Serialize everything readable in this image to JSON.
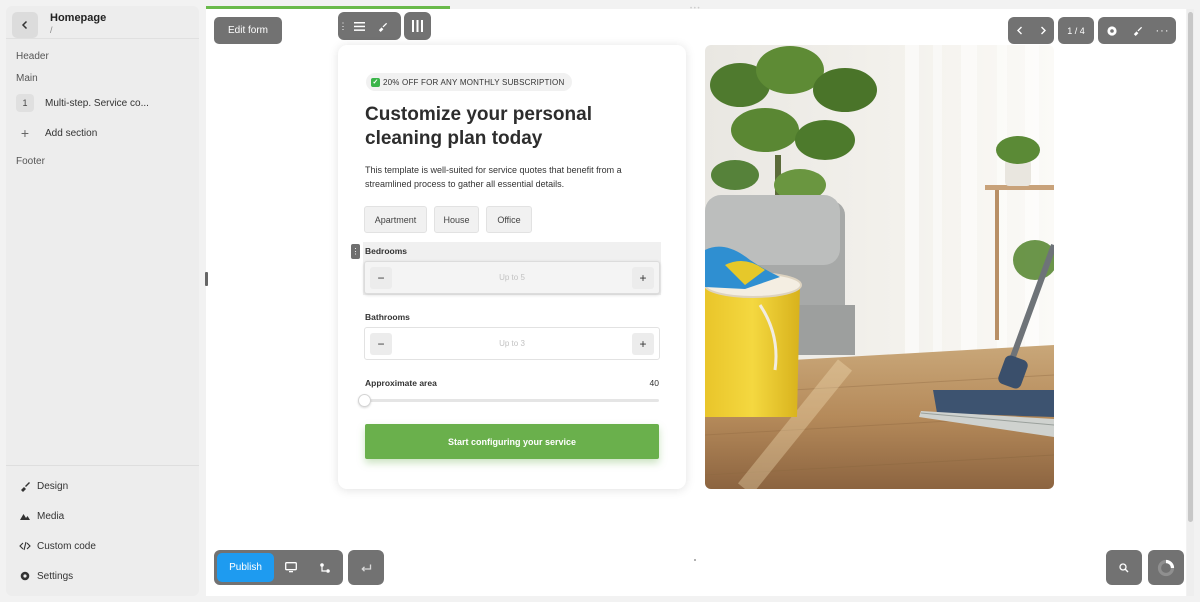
{
  "sidebar": {
    "page_title": "Homepage",
    "page_path": "/",
    "sections": {
      "header": "Header",
      "main": "Main",
      "footer": "Footer"
    },
    "main_items": [
      {
        "number": "1",
        "label": "Multi-step. Service co..."
      }
    ],
    "add_section_label": "Add section",
    "bottom_items": [
      {
        "label": "Design",
        "icon": "brush-icon"
      },
      {
        "label": "Media",
        "icon": "mountain-icon"
      },
      {
        "label": "Custom code",
        "icon": "code-icon"
      },
      {
        "label": "Settings",
        "icon": "gear-icon"
      }
    ]
  },
  "toolbar": {
    "edit_form_label": "Edit form",
    "pagination": "1 / 4",
    "publish_label": "Publish"
  },
  "form": {
    "promo": "20% OFF FOR ANY MONTHLY SUBSCRIPTION",
    "headline": "Customize your personal cleaning plan today",
    "description": "This template is well-suited for service quotes that benefit from a streamlined process to gather all essential details.",
    "property_types": [
      "Apartment",
      "House",
      "Office"
    ],
    "bedrooms": {
      "label": "Bedrooms",
      "placeholder": "Up to 5"
    },
    "bathrooms": {
      "label": "Bathrooms",
      "placeholder": "Up to 3"
    },
    "area": {
      "label": "Approximate area",
      "value": "40"
    },
    "cta_label": "Start configuring your service"
  },
  "colors": {
    "accent_green": "#6ab04c",
    "publish_blue": "#1e9bf0",
    "toolbar_gray": "#727272"
  }
}
